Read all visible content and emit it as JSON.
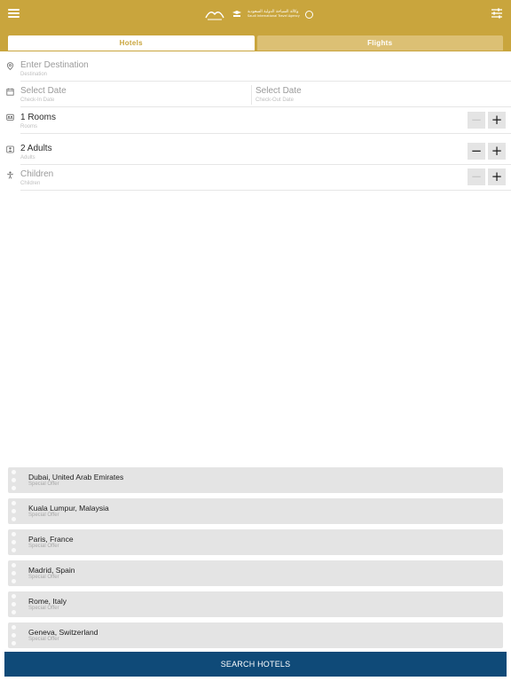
{
  "header": {
    "logo_text_line1": "وكالة السياحة الدولية السعودية",
    "logo_text_line2": "Saudi International Travel Agency",
    "brand_color": "#c9a53d",
    "icons": {
      "menu": "hamburger-menu-icon",
      "filter": "sliders-filter-icon"
    }
  },
  "tabs": [
    {
      "label": "Hotels",
      "active": true
    },
    {
      "label": "Flights",
      "active": false
    }
  ],
  "form": {
    "destination": {
      "value": "Enter Destination",
      "label": "Destination"
    },
    "check_in": {
      "value": "Select Date",
      "label": "Check-In Date"
    },
    "check_out": {
      "value": "Select Date",
      "label": "Check-Out Date"
    },
    "rooms": {
      "value": "1 Rooms",
      "label": "Rooms"
    },
    "adults": {
      "value": "2 Adults",
      "label": "Adults"
    },
    "children": {
      "value": "Children",
      "label": "Children"
    },
    "stepper": {
      "minus": "−",
      "plus": "+"
    }
  },
  "offers": [
    {
      "city": "Dubai, United Arab Emirates",
      "tag": "Special Offer"
    },
    {
      "city": "Kuala Lumpur, Malaysia",
      "tag": "Special Offer"
    },
    {
      "city": "Paris, France",
      "tag": "Special Offer"
    },
    {
      "city": "Madrid, Spain",
      "tag": "Special Offer"
    },
    {
      "city": "Rome, Italy",
      "tag": "Special Offer"
    },
    {
      "city": "Geneva, Switzerland",
      "tag": "Special Offer"
    }
  ],
  "search_button": {
    "label": "SEARCH HOTELS",
    "color": "#0f4a78"
  }
}
